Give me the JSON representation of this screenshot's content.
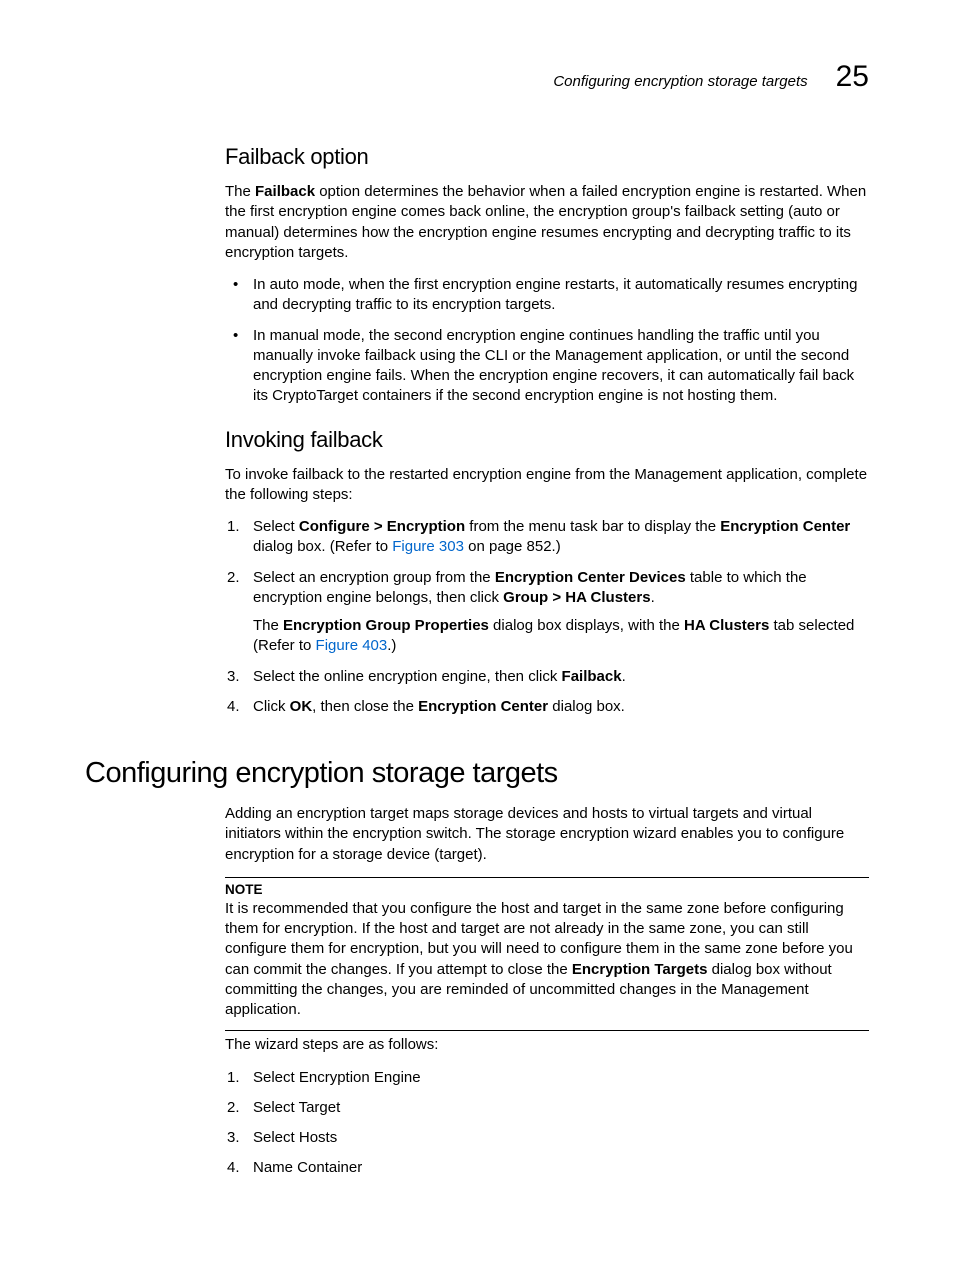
{
  "header": {
    "running_title": "Configuring encryption storage targets",
    "chapter_number": "25"
  },
  "sec_failback": {
    "title": "Failback option",
    "intro_pre": "The ",
    "intro_bold": "Failback",
    "intro_post": " option determines the behavior when a failed encryption engine is restarted. When the first encryption engine comes back online, the encryption group's failback setting (auto or manual) determines how the encryption engine resumes encrypting and decrypting traffic to its encryption targets.",
    "bullets": [
      "In auto mode, when the first encryption engine restarts, it automatically resumes encrypting and decrypting traffic to its encryption targets.",
      "In manual mode, the second encryption engine continues handling the traffic until you manually invoke failback using the CLI or the Management application, or until the second encryption engine fails. When the encryption engine recovers, it can automatically fail back its CryptoTarget containers if the second encryption engine is not hosting them."
    ]
  },
  "sec_invoke": {
    "title": "Invoking failback",
    "intro": "To invoke failback to the restarted encryption engine from the Management application, complete the following steps:",
    "step1": {
      "pre": "Select ",
      "b1": "Configure > Encryption",
      "mid": " from the menu task bar to display the ",
      "b2": "Encryption Center",
      "post1": " dialog box. (Refer to ",
      "link": "Figure 303",
      "post2": " on page 852.)"
    },
    "step2": {
      "pre": "Select an encryption group from the ",
      "b1": "Encryption Center Devices",
      "mid": " table to which the encryption engine belongs, then click ",
      "b2": "Group > HA Clusters",
      "post": ".",
      "para_pre": "The ",
      "para_b1": "Encryption Group Properties",
      "para_mid": " dialog box displays, with the ",
      "para_b2": "HA Clusters",
      "para_post1": " tab selected (Refer to ",
      "para_link": "Figure 403",
      "para_post2": ".)"
    },
    "step3": {
      "pre": "Select the online encryption engine, then click ",
      "b1": "Failback",
      "post": "."
    },
    "step4": {
      "pre": "Click ",
      "b1": "OK",
      "mid": ", then close the ",
      "b2": "Encryption Center",
      "post": " dialog box."
    }
  },
  "sec_config": {
    "title": "Configuring encryption storage targets",
    "intro": "Adding an encryption target maps storage devices and hosts to virtual targets and virtual initiators within the encryption switch. The storage encryption wizard enables you to configure encryption for a storage device (target).",
    "note_label": "NOTE",
    "note_pre": "It is recommended that you configure the host and target in the same zone before configuring them for encryption. If the host and target are not already in the same zone, you can still configure them for encryption, but you will need to configure them in the same zone before you can commit the changes. If you attempt to close the ",
    "note_b": "Encryption Targets",
    "note_post": " dialog box without committing the changes, you are reminded of uncommitted changes in the Management application.",
    "wizard_intro": "The wizard steps are as follows:",
    "wizard_steps": [
      "Select Encryption Engine",
      "Select Target",
      "Select Hosts",
      "Name Container"
    ]
  }
}
